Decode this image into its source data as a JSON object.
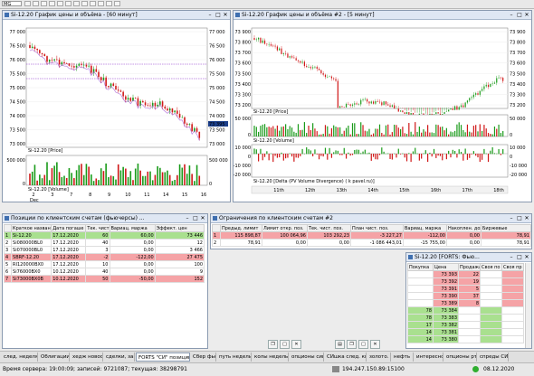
{
  "toolbar": {
    "profile": "MG"
  },
  "win1": {
    "title": "Si-12.20 График цены и объёма - [60 минут]",
    "price_label": "Si-12.20 [Price]",
    "volume_label": "Si-12.20 [Volume]",
    "price_ticks": [
      "77 000",
      "76 500",
      "76 000",
      "75 500",
      "75 000",
      "74 500",
      "74 000",
      "73 500",
      "73 000"
    ],
    "price_ticks_right": [
      "77 000",
      "76 500",
      "76 000",
      "75 500",
      "75 000",
      "74 500",
      "74 000",
      "73 500",
      "73 000"
    ],
    "last_price": "73 395",
    "volume_ticks": [
      "500 000",
      "0"
    ],
    "volume_ticks_right": [
      "500 000",
      "0"
    ],
    "x_ticks": [
      "2",
      "3",
      "7",
      "8",
      "9",
      "10",
      "11",
      "14",
      "15",
      "16"
    ],
    "x_sub": "Dec"
  },
  "win2": {
    "title": "Si-12.20 График цены и объёма #2 - [5 минут]",
    "price_label": "Si-12.20 [Price]",
    "volume_label": "Si-12.20 [Volume]",
    "delta_label": "Si-12.20 [Delta (PV Volume Divergence) ( k pavel.ru)]",
    "price_ticks": [
      "73 900",
      "73 800",
      "73 700",
      "73 600",
      "73 500",
      "73 400",
      "73 300",
      "73 200"
    ],
    "price_ticks_right": [
      "73 900",
      "73 800",
      "73 700",
      "73 600",
      "73 500",
      "73 400",
      "73 300",
      "73 200"
    ],
    "volume_ticks": [
      "50 000",
      "0"
    ],
    "volume_ticks_right": [
      "50 000",
      "0"
    ],
    "delta_ticks": [
      "10 000",
      "0",
      "-10 000",
      "-20 000"
    ],
    "delta_ticks_right": [
      "10 000",
      "0",
      "-10 000",
      "-20 000"
    ],
    "x_ticks": [
      "11th",
      "12th",
      "13th",
      "14th",
      "15th",
      "16th",
      "17th",
      "18th"
    ]
  },
  "positions": {
    "title": "Позиции по клиентским счетам (фьючерсы) ...",
    "headers": [
      "Краткое название",
      "Дата погаше",
      "Тек. чист.",
      "Вариац. маржа",
      "Эффект. цен"
    ],
    "rows": [
      {
        "cls": "g",
        "cells": [
          "Si-12.20",
          "17.12.2020",
          "60",
          "60,00",
          "73 446"
        ]
      },
      {
        "cls": "w",
        "cells": [
          "Si080000BL0",
          "17.12.2020",
          "40",
          "0,00",
          "12"
        ]
      },
      {
        "cls": "w",
        "cells": [
          "Si070000BL0",
          "17.12.2020",
          "3",
          "0,00",
          "3 466"
        ]
      },
      {
        "cls": "p",
        "cells": [
          "SBRF-12.20",
          "17.12.2020",
          "-2",
          "-122,00",
          "27 475"
        ]
      },
      {
        "cls": "w",
        "cells": [
          "RI120000BX0",
          "17.12.2020",
          "10",
          "0,00",
          "100"
        ]
      },
      {
        "cls": "w",
        "cells": [
          "Si76000BX0",
          "10.12.2020",
          "40",
          "0,00",
          "9"
        ]
      },
      {
        "cls": "p",
        "cells": [
          "Si73000BX0B",
          "10.12.2020",
          "50",
          "-50,00",
          "152"
        ]
      }
    ]
  },
  "limits": {
    "title": "Ограничения по клиентским счетам #2",
    "headers": [
      "",
      "Предыд. лимит",
      "Лимит откр. поз.",
      "Тек. чист. поз.",
      "План чист. поз.",
      "Вариац. маржа",
      "Накоплен. доход",
      "Биржевые"
    ],
    "rows": [
      {
        "cls": "p",
        "cells": [
          "1",
          "115 898,87",
          "100 064,96",
          "103 292,23",
          "-3 227,27",
          "-112,00",
          "0,00",
          "78,91"
        ]
      },
      {
        "cls": "w",
        "cells": [
          "2",
          "78,91",
          "0,00",
          "0,00",
          "-1 086 443,01",
          "-15 755,00",
          "0,00",
          "78,91"
        ]
      }
    ]
  },
  "orderbook": {
    "title": "Si-12.20 [FORTS: Фью...",
    "headers": [
      "Покупка",
      "Цена",
      "Продажа",
      "Своя по",
      "Своя пр"
    ],
    "rows": [
      {
        "buy": "",
        "price": "73 393",
        "sell": "22",
        "side": "s"
      },
      {
        "buy": "",
        "price": "73 392",
        "sell": "19",
        "side": "s"
      },
      {
        "buy": "",
        "price": "73 391",
        "sell": "5",
        "side": "s"
      },
      {
        "buy": "",
        "price": "73 390",
        "sell": "37",
        "side": "s"
      },
      {
        "buy": "",
        "price": "73 389",
        "sell": "8",
        "side": "s"
      },
      {
        "buy": "78",
        "price": "73 384",
        "sell": "",
        "side": "b"
      },
      {
        "buy": "78",
        "price": "73 383",
        "sell": "",
        "side": "b"
      },
      {
        "buy": "17",
        "price": "73 382",
        "sell": "",
        "side": "b"
      },
      {
        "buy": "14",
        "price": "73 381",
        "sell": "",
        "side": "b"
      },
      {
        "buy": "14",
        "price": "73 380",
        "sell": "",
        "side": "b"
      }
    ]
  },
  "tabs": [
    "след. неделя.",
    "Облигации",
    "хедж новости",
    "сделки, заявки",
    "FORTS \"СИ\" позиции...",
    "Сбер фью",
    "путь недельки",
    "колы недельки",
    "опционы сишка",
    "СИшка след. квартал",
    "золото.",
    "нефть",
    "интересно",
    "опционы ртс",
    "спреды СИ"
  ],
  "status": {
    "server": "Время сервера: 19:00:09; записей: 9721087; текущая: 38298791",
    "ip": "194.247.150.89:15100",
    "date": "08.12.2020"
  },
  "colors": {
    "up": "#1a9b1a",
    "down": "#d01818",
    "ma": "#8b2fc9",
    "bg_green": "#a9e08f",
    "bg_pink": "#f5a3a6"
  }
}
